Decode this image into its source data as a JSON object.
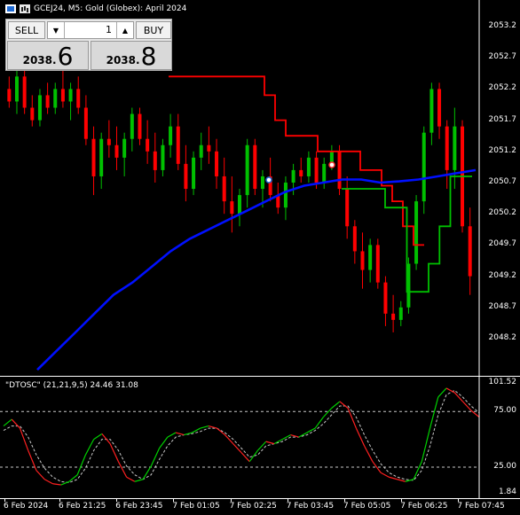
{
  "window_title": "GCEJ24, M5:  Gold (Globex): April 2024",
  "icons": {
    "chart_window": "chart-window-icon",
    "bars_type": "bars-type-icon"
  },
  "trade_panel": {
    "sell_label": "SELL",
    "buy_label": "BUY",
    "lot_value": "1",
    "sell_price_small": "2038",
    "sell_price_big": "6",
    "buy_price_small": "2038",
    "buy_price_big": "8"
  },
  "price_axis": [
    "2053.2",
    "2052.7",
    "2052.2",
    "2051.7",
    "2051.2",
    "2050.7",
    "2050.2",
    "2049.7",
    "2049.2",
    "2048.7",
    "2048.2"
  ],
  "indicator": {
    "title": "\"DTOSC\" (21,21,9,5) 24.46 31.08",
    "axis": [
      "101.52",
      "75.00",
      "25.00",
      "1.84"
    ]
  },
  "time_axis": [
    "6 Feb 2024",
    "6 Feb 21:25",
    "6 Feb 23:45",
    "7 Feb 01:05",
    "7 Feb 02:25",
    "7 Feb 03:45",
    "7 Feb 05:05",
    "7 Feb 06:25",
    "7 Feb 07:45"
  ],
  "colors": {
    "bull": "#00c000",
    "bear": "#ff0000",
    "ma": "#0010ff",
    "stop_red": "#ff0000",
    "stop_green": "#00c000",
    "osc_fast_bull": "#00d000",
    "osc_fast_bear": "#ff2020",
    "osc_slow": "#c8c8c8"
  },
  "chart_data": {
    "type": "candlestick",
    "symbol": "GCEJ24",
    "timeframe": "M5",
    "price_range": [
      2047.75,
      2053.35
    ],
    "candles": [
      [
        2052.2,
        2052.4,
        2051.9,
        2052.0
      ],
      [
        2052.0,
        2052.5,
        2051.8,
        2052.4
      ],
      [
        2052.4,
        2052.6,
        2051.8,
        2051.9
      ],
      [
        2051.9,
        2052.1,
        2051.6,
        2051.7
      ],
      [
        2051.7,
        2052.2,
        2051.6,
        2052.1
      ],
      [
        2052.1,
        2052.3,
        2051.8,
        2051.9
      ],
      [
        2051.9,
        2052.3,
        2051.8,
        2052.2
      ],
      [
        2052.2,
        2052.5,
        2051.9,
        2052.0
      ],
      [
        2052.0,
        2052.3,
        2051.7,
        2052.2
      ],
      [
        2052.2,
        2052.4,
        2051.8,
        2051.9
      ],
      [
        2051.9,
        2052.1,
        2051.3,
        2051.4
      ],
      [
        2051.4,
        2051.6,
        2050.5,
        2050.8
      ],
      [
        2050.8,
        2051.5,
        2050.6,
        2051.4
      ],
      [
        2051.4,
        2051.7,
        2051.1,
        2051.3
      ],
      [
        2051.3,
        2051.6,
        2050.9,
        2051.1
      ],
      [
        2051.1,
        2051.5,
        2050.8,
        2051.4
      ],
      [
        2051.4,
        2051.9,
        2051.2,
        2051.8
      ],
      [
        2051.8,
        2051.9,
        2051.3,
        2051.4
      ],
      [
        2051.4,
        2051.7,
        2051.0,
        2051.2
      ],
      [
        2051.2,
        2051.5,
        2050.7,
        2050.9
      ],
      [
        2050.9,
        2051.4,
        2050.8,
        2051.3
      ],
      [
        2051.3,
        2051.8,
        2051.1,
        2051.6
      ],
      [
        2051.6,
        2051.8,
        2050.9,
        2051.0
      ],
      [
        2051.0,
        2051.3,
        2050.4,
        2050.6
      ],
      [
        2050.6,
        2051.2,
        2050.5,
        2051.1
      ],
      [
        2051.1,
        2051.5,
        2050.9,
        2051.3
      ],
      [
        2051.3,
        2051.6,
        2051.0,
        2051.2
      ],
      [
        2051.2,
        2051.4,
        2050.6,
        2050.8
      ],
      [
        2050.8,
        2051.1,
        2050.2,
        2050.4
      ],
      [
        2050.4,
        2050.8,
        2049.9,
        2050.2
      ],
      [
        2050.2,
        2050.6,
        2050.0,
        2050.5
      ],
      [
        2050.5,
        2051.4,
        2050.3,
        2051.3
      ],
      [
        2051.3,
        2051.4,
        2050.5,
        2050.6
      ],
      [
        2050.6,
        2050.9,
        2050.3,
        2050.8
      ],
      [
        2050.8,
        2051.1,
        2050.4,
        2050.5
      ],
      [
        2050.5,
        2050.7,
        2050.2,
        2050.3
      ],
      [
        2050.3,
        2050.8,
        2050.1,
        2050.7
      ],
      [
        2050.7,
        2051.0,
        2050.5,
        2050.9
      ],
      [
        2050.9,
        2051.1,
        2050.7,
        2050.8
      ],
      [
        2050.8,
        2051.2,
        2050.7,
        2051.1
      ],
      [
        2051.1,
        2051.2,
        2050.6,
        2050.7
      ],
      [
        2050.7,
        2051.1,
        2050.6,
        2051.0
      ],
      [
        2051.0,
        2051.3,
        2050.9,
        2051.2
      ],
      [
        2051.2,
        2051.3,
        2050.5,
        2050.6
      ],
      [
        2050.6,
        2050.8,
        2049.8,
        2050.0
      ],
      [
        2050.0,
        2050.1,
        2049.4,
        2049.6
      ],
      [
        2049.6,
        2049.9,
        2049.0,
        2049.3
      ],
      [
        2049.3,
        2049.8,
        2049.1,
        2049.7
      ],
      [
        2049.7,
        2049.8,
        2049.0,
        2049.1
      ],
      [
        2049.1,
        2049.2,
        2048.4,
        2048.6
      ],
      [
        2048.6,
        2048.9,
        2048.3,
        2048.5
      ],
      [
        2048.5,
        2048.8,
        2048.4,
        2048.7
      ],
      [
        2048.7,
        2049.5,
        2048.6,
        2049.4
      ],
      [
        2049.4,
        2050.5,
        2049.3,
        2050.4
      ],
      [
        2050.4,
        2051.6,
        2050.2,
        2051.5
      ],
      [
        2051.5,
        2052.3,
        2051.3,
        2052.2
      ],
      [
        2052.2,
        2052.3,
        2051.4,
        2051.6
      ],
      [
        2051.6,
        2051.7,
        2050.6,
        2050.9
      ],
      [
        2050.9,
        2051.9,
        2050.6,
        2051.6
      ],
      [
        2051.6,
        2051.7,
        2049.9,
        2050.0
      ],
      [
        2050.0,
        2050.3,
        2048.9,
        2049.2
      ]
    ],
    "moving_average": [
      2047.7,
      2048.0,
      2048.3,
      2048.6,
      2048.9,
      2049.1,
      2049.35,
      2049.6,
      2049.8,
      2049.95,
      2050.1,
      2050.25,
      2050.4,
      2050.55,
      2050.65,
      2050.7,
      2050.75,
      2050.75,
      2050.7,
      2050.72,
      2050.75,
      2050.8,
      2050.85,
      2050.9
    ],
    "stop_line_red": [
      2052.4,
      2052.4,
      2052.4,
      2052.4,
      2052.4,
      2052.4,
      2052.4,
      2052.4,
      2052.4,
      2052.1,
      2051.7,
      2051.45,
      2051.45,
      2051.45,
      2051.2,
      2051.2,
      2051.2,
      2051.2,
      2050.9,
      2050.9,
      2050.65,
      2050.4,
      2050.0,
      2049.7,
      2049.7
    ],
    "stop_line_green": [
      2050.6,
      2050.6,
      2050.6,
      2050.6,
      2050.3,
      2050.3,
      2048.95,
      2048.95,
      2049.4,
      2050.0,
      2050.8,
      2050.8,
      2050.8
    ],
    "oscillator": {
      "fast": [
        62,
        68,
        60,
        40,
        22,
        14,
        10,
        9,
        12,
        18,
        36,
        50,
        55,
        46,
        30,
        16,
        12,
        14,
        26,
        42,
        52,
        56,
        54,
        56,
        60,
        62,
        60,
        54,
        46,
        38,
        30,
        40,
        48,
        46,
        50,
        54,
        52,
        56,
        60,
        70,
        78,
        84,
        78,
        60,
        44,
        30,
        20,
        16,
        14,
        12,
        14,
        30,
        60,
        88,
        96,
        92,
        84,
        76,
        70
      ],
      "slow": [
        58,
        62,
        62,
        52,
        36,
        24,
        16,
        12,
        11,
        14,
        24,
        40,
        50,
        50,
        40,
        26,
        18,
        14,
        18,
        32,
        44,
        52,
        54,
        55,
        57,
        60,
        60,
        56,
        50,
        42,
        34,
        36,
        44,
        46,
        48,
        52,
        52,
        54,
        58,
        64,
        72,
        80,
        80,
        70,
        54,
        40,
        28,
        20,
        16,
        14,
        13,
        22,
        44,
        72,
        90,
        94,
        88,
        80,
        74
      ],
      "levels": [
        75,
        25
      ],
      "range": [
        1.84,
        101.52
      ]
    }
  }
}
